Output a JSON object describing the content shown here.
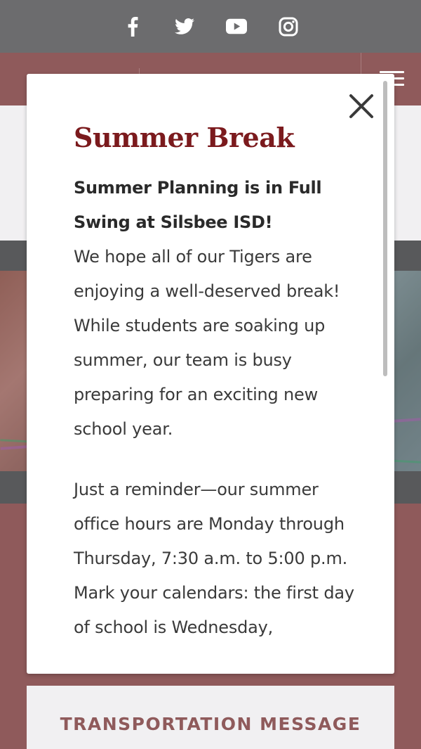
{
  "social": {
    "items": [
      {
        "name": "facebook"
      },
      {
        "name": "twitter"
      },
      {
        "name": "youtube"
      },
      {
        "name": "instagram"
      }
    ]
  },
  "modal": {
    "title": "Summer Break",
    "subtitle": "Summer Planning is in Full Swing at Silsbee ISD!",
    "paragraph_1": "We hope all of our Tigers are enjoying a well-deserved break! While students are soaking up summer, our team is busy preparing for an exciting new school year.",
    "paragraph_2": "Just a reminder—our summer office hours are Monday through Thursday, 7:30 a.m. to 5:00 p.m.",
    "paragraph_3": "Mark your calendars: the first day of school is Wednesday,"
  },
  "cards": {
    "transportation_title": "TRANSPORTATION MESSAGE"
  },
  "colors": {
    "maroon": "#8f5a5b",
    "title_red": "#7b1a1d",
    "social_gray": "#6c6c6e"
  }
}
